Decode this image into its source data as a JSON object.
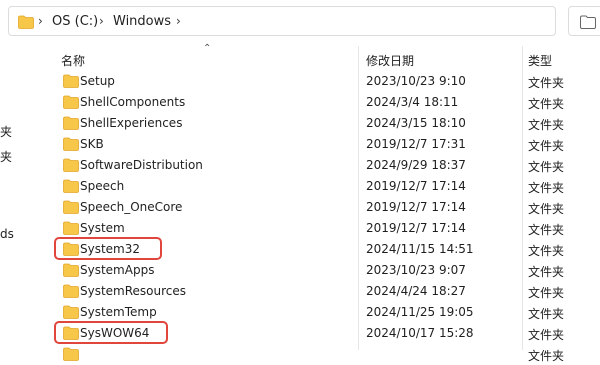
{
  "address_bar": {
    "crumbs": [
      "OS (C:)",
      "Windows"
    ]
  },
  "nav": {
    "items": [
      "夹",
      "夹",
      "ds"
    ]
  },
  "columns": {
    "name": "名称",
    "modified": "修改日期",
    "type": "类型"
  },
  "rows": [
    {
      "name": "Setup",
      "date": "2023/10/23 9:10",
      "type": "文件夹"
    },
    {
      "name": "ShellComponents",
      "date": "2024/3/4 18:11",
      "type": "文件夹"
    },
    {
      "name": "ShellExperiences",
      "date": "2024/3/15 18:10",
      "type": "文件夹"
    },
    {
      "name": "SKB",
      "date": "2019/12/7 17:31",
      "type": "文件夹"
    },
    {
      "name": "SoftwareDistribution",
      "date": "2024/9/29 18:37",
      "type": "文件夹"
    },
    {
      "name": "Speech",
      "date": "2019/12/7 17:14",
      "type": "文件夹"
    },
    {
      "name": "Speech_OneCore",
      "date": "2019/12/7 17:14",
      "type": "文件夹"
    },
    {
      "name": "System",
      "date": "2019/12/7 17:14",
      "type": "文件夹"
    },
    {
      "name": "System32",
      "date": "2024/11/15 14:51",
      "type": "文件夹"
    },
    {
      "name": "SystemApps",
      "date": "2023/10/23 9:07",
      "type": "文件夹"
    },
    {
      "name": "SystemResources",
      "date": "2024/4/24 18:27",
      "type": "文件夹"
    },
    {
      "name": "SystemTemp",
      "date": "2024/11/25 19:05",
      "type": "文件夹"
    },
    {
      "name": "SysWOW64",
      "date": "2024/10/17 15:28",
      "type": "文件夹"
    },
    {
      "name": "",
      "date": "",
      "type": "文件夹"
    }
  ],
  "colors": {
    "folder": "#f6c748",
    "folder_dark": "#e4a62a",
    "highlight": "#e0463c"
  },
  "highlighted_rows": [
    "System32",
    "SysWOW64"
  ]
}
